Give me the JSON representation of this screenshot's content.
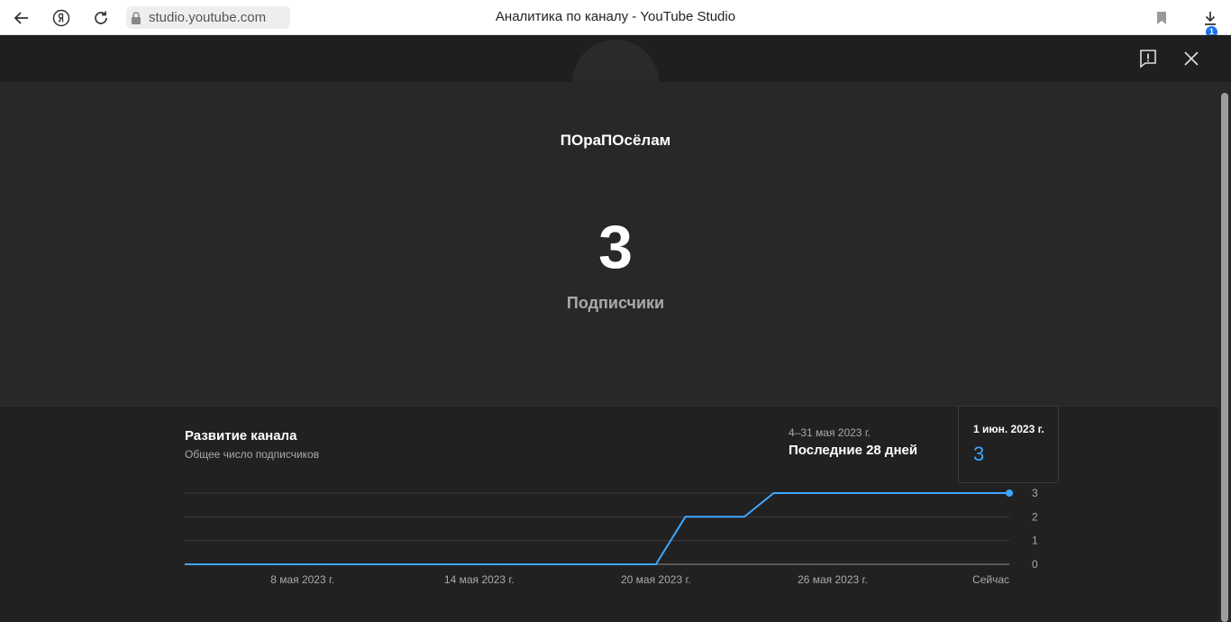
{
  "browser": {
    "url": "studio.youtube.com",
    "tab_title": "Аналитика по каналу - YouTube Studio",
    "download_count": "1",
    "icons": [
      "back-arrow-icon",
      "yandex-icon",
      "reload-icon",
      "lock-icon",
      "bookmark-icon",
      "download-icon"
    ]
  },
  "header": {
    "icons": [
      "feedback-icon",
      "close-icon"
    ]
  },
  "channel": {
    "name": "ПОраПОсёлам",
    "subscribers": "3",
    "subscribers_label": "Подписчики"
  },
  "chart_section": {
    "title": "Развитие канала",
    "subtitle": "Общее число подписчиков",
    "date_range": "4–31 мая 2023 г.",
    "period": "Последние 28 дней",
    "tooltip": {
      "date": "1 июн. 2023 г.",
      "value": "3"
    }
  },
  "chart_data": {
    "type": "line",
    "title": "",
    "xlabel": "",
    "ylabel": "",
    "x_tick_labels": [
      "8 мая 2023 г.",
      "14 мая 2023 г.",
      "20 мая 2023 г.",
      "26 мая 2023 г.",
      "Сейчас"
    ],
    "y_tick_labels": [
      "0",
      "1",
      "2",
      "3"
    ],
    "ylim": [
      0,
      3
    ],
    "y_axis_side": "right",
    "grid": true,
    "line_color": "#3ea6ff",
    "series": [
      {
        "points": [
          {
            "x": "4 мая 2023 г.",
            "y": 0
          },
          {
            "x": "20 мая 2023 г.",
            "y": 0
          },
          {
            "x": "21 мая 2023 г.",
            "y": 2
          },
          {
            "x": "23 мая 2023 г.",
            "y": 2
          },
          {
            "x": "24 мая 2023 г.",
            "y": 3
          },
          {
            "x": "1 июн. 2023 г.",
            "y": 3
          }
        ]
      }
    ]
  }
}
